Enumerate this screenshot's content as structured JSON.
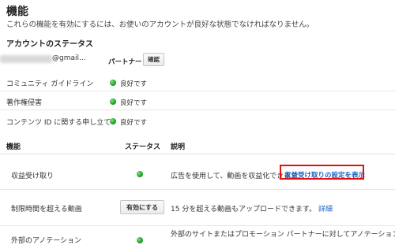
{
  "page": {
    "title": "機能",
    "subtitle": "これらの機能を有効にするには、お使いのアカウントが良好な状態でなければなりません。"
  },
  "account_status": {
    "section_title": "アカウントのステータス",
    "email_suffix": "@gmail...",
    "partner_label": "パートナー",
    "confirm_button": "確認",
    "rows": [
      {
        "label": "コミュニティ ガイドライン",
        "status": "良好です"
      },
      {
        "label": "著作権侵害",
        "status": "良好です"
      },
      {
        "label": "コンテンツ ID に関する申し立て",
        "status": "良好です"
      }
    ],
    "status_color": "#1e9e28"
  },
  "features": {
    "headers": {
      "feature": "機能",
      "status": "ステータス",
      "description": "説明"
    },
    "rows": [
      {
        "name": "収益受け取り",
        "description": "広告を使用して、動画を収益化できます",
        "link": "収益受け取りの設定を表示"
      },
      {
        "name": "制限時間を超える動画",
        "button": "有効にする",
        "description": "15 分を超える動画もアップロードできます。",
        "link": "詳細"
      },
      {
        "name": "外部のアノテーション",
        "description": "外部のサイトまたはプロモーション パートナーに対してアノテーションの"
      }
    ]
  },
  "colors": {
    "link": "#1a62c4",
    "highlight_border": "#e21212"
  }
}
